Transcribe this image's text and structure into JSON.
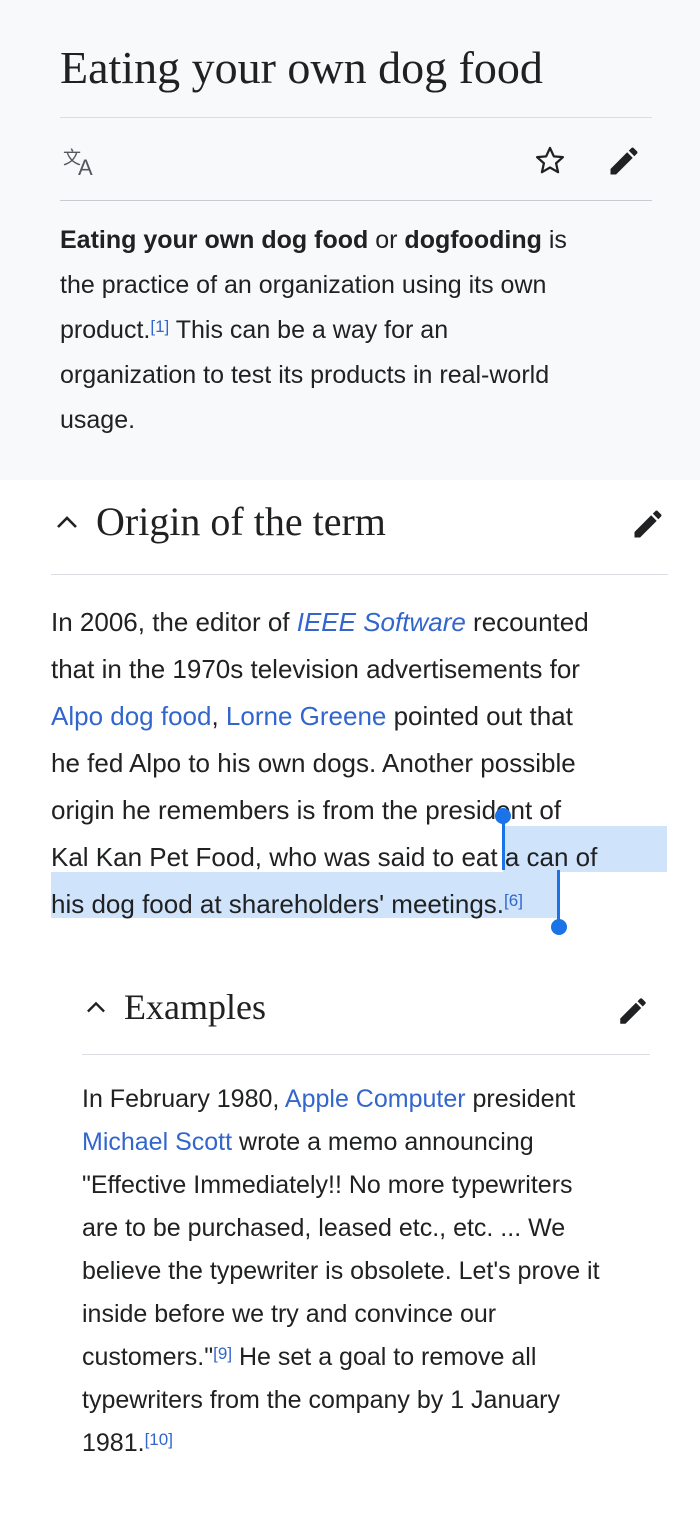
{
  "article": {
    "title": "Eating your own dog food"
  },
  "toolbar": {
    "language_icon": "translate-icon",
    "watch_icon": "star-icon",
    "edit_icon": "pencil-icon"
  },
  "lead": {
    "term1": "Eating your own dog food",
    "or": " or ",
    "term2": "dogfooding",
    "is": " is",
    "line2": "the practice of an organization using its own",
    "line3_start": "product.",
    "ref1": "[1]",
    "line3_end": " This can be a way for an",
    "line4": "organization to test its products in real-world",
    "line5": "usage."
  },
  "sections": {
    "origin": {
      "heading": "Origin of the term",
      "l1_a": "In 2006, the editor of ",
      "l1_link": "IEEE Software",
      "l1_b": " recounted",
      "l2": "that in the 1970s television advertisements for",
      "l3_link1": "Alpo dog food",
      "l3_mid": ", ",
      "l3_link2": "Lorne Greene",
      "l3_b": " pointed out that",
      "l4": "he fed Alpo to his own dogs. Another possible",
      "l5": "origin he remembers is from the president of",
      "l6_a": "Kal Kan Pet Food, who was said to ",
      "l6_sel": "eat a can of",
      "l7_sel": "his dog food at shareholders' meetings.",
      "ref6": "[6]"
    },
    "examples": {
      "heading": "Examples",
      "l1_a": "In February 1980, ",
      "l1_link": "Apple Computer",
      "l1_b": " president",
      "l2_link": "Michael Scott",
      "l2_b": " wrote a memo announcing",
      "l3": "\"Effective Immediately!! No more typewriters",
      "l4": "are to be purchased, leased etc., etc. ... We",
      "l5": "believe the typewriter is obsolete. Let's prove it",
      "l6": "inside before we try and convince our",
      "l7_a": "customers.\"",
      "ref9": "[9]",
      "l7_b": " He set a goal to remove all",
      "l8": "typewriters from the company by 1 January",
      "l9_a": "1981.",
      "ref10": "[10]"
    }
  },
  "colors": {
    "link": "#3366cc",
    "selection": "#cfe3fb",
    "selection_handle": "#1a73e8",
    "lead_background": "#f8f9fa"
  }
}
